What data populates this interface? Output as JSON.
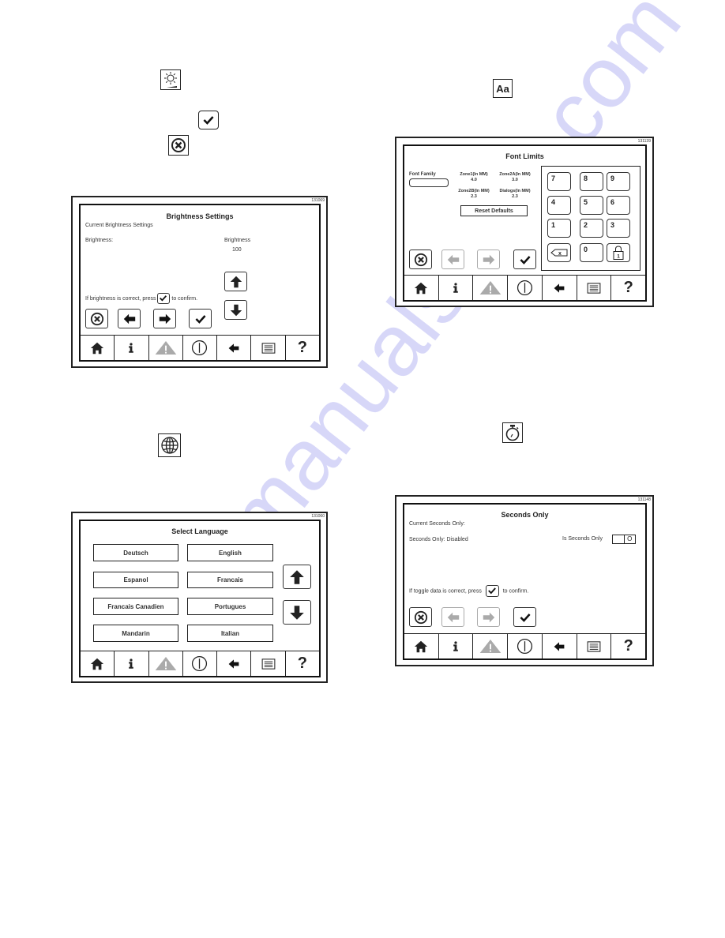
{
  "watermark": "manualshive.com",
  "intro_icons": {
    "brightness": "brightness-icon",
    "confirm": "checkmark-icon",
    "cancel": "cancel-x-icon",
    "language": "globe-icon",
    "font": "font-aa-icon",
    "font_label": "Aa",
    "seconds": "stopwatch-icon"
  },
  "nav_bar": {
    "items": [
      {
        "icon": "home-icon"
      },
      {
        "icon": "info-icon"
      },
      {
        "icon": "warning-icon",
        "state": "disabled"
      },
      {
        "icon": "power-icon"
      },
      {
        "icon": "back-arrow-icon"
      },
      {
        "icon": "menu-list-icon"
      },
      {
        "icon": "help-icon",
        "label": "?"
      }
    ]
  },
  "brightness_screen": {
    "figure_id": "131069",
    "title": "Brightness Settings",
    "subtitle": "Current Brightness Settings",
    "field_label": "Brightness:",
    "value_label": "Brightness",
    "value": "100",
    "instruction_before": "If brightness is correct, press",
    "instruction_after": "to confirm.",
    "buttons": [
      "cancel",
      "previous",
      "next",
      "confirm",
      "up",
      "down"
    ]
  },
  "language_screen": {
    "figure_id": "131060",
    "title": "Select Language",
    "languages": [
      "Deutsch",
      "English",
      "Espanol",
      "Francais",
      "Francais Canadien",
      "Portugues",
      "Mandarin",
      "Italian"
    ],
    "buttons": [
      "scroll-up",
      "scroll-down"
    ]
  },
  "font_limits_screen": {
    "figure_id": "131139",
    "title": "Font Limits",
    "font_family_label": "Font Family",
    "font_family_value": "",
    "zones": [
      {
        "label": "Zone1(In MM)",
        "value": "4.0"
      },
      {
        "label": "Zone2A(In MM)",
        "value": "3.0"
      },
      {
        "label": "Zone2B(In MM)",
        "value": "2.3"
      },
      {
        "label": "Dialogs(In MM)",
        "value": "2.3"
      }
    ],
    "reset_label": "Reset Defaults",
    "keypad": [
      "7",
      "8",
      "9",
      "4",
      "5",
      "6",
      "1",
      "2",
      "3",
      "backspace",
      "0",
      "lock"
    ],
    "lock_label": "1",
    "backspace_label": "x",
    "buttons": [
      {
        "name": "cancel",
        "state": "enabled"
      },
      {
        "name": "previous",
        "state": "disabled"
      },
      {
        "name": "next",
        "state": "disabled"
      },
      {
        "name": "confirm",
        "state": "enabled"
      }
    ]
  },
  "seconds_only_screen": {
    "figure_id": "131148",
    "title": "Seconds Only",
    "subtitle": "Current Seconds Only:",
    "status": "Seconds Only: Disabled",
    "toggle_label": "Is Seconds Only",
    "toggle_value": "O",
    "instruction_before": "If toggle data is correct, press",
    "instruction_after": "to confirm.",
    "buttons": [
      {
        "name": "cancel",
        "state": "enabled"
      },
      {
        "name": "previous",
        "state": "disabled"
      },
      {
        "name": "next",
        "state": "disabled"
      },
      {
        "name": "confirm",
        "state": "enabled"
      }
    ]
  }
}
